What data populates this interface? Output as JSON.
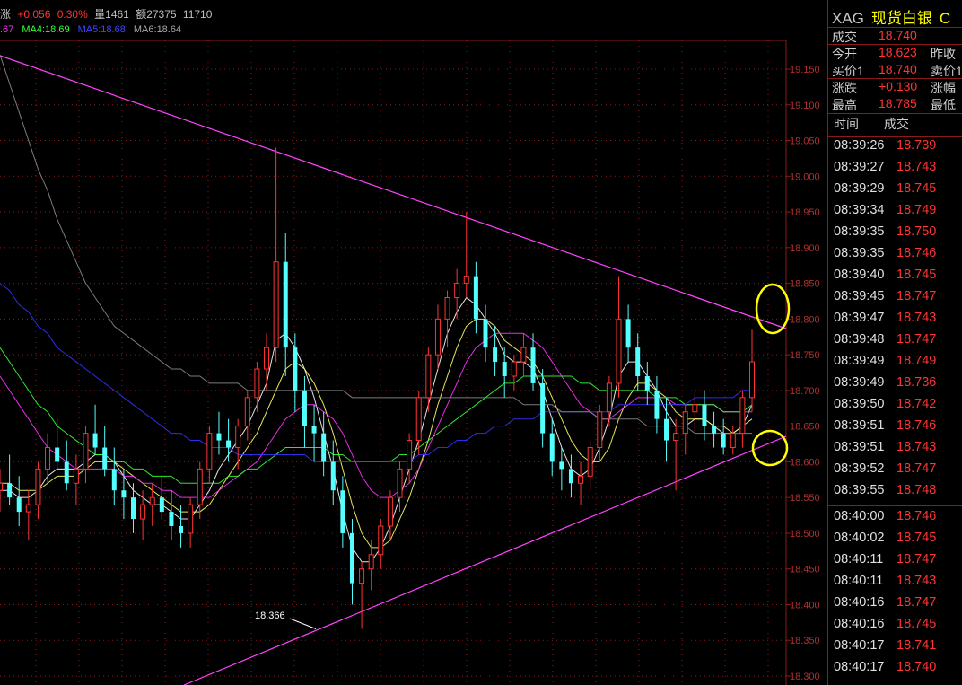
{
  "header": {
    "change_label": "涨",
    "change": "+0.056",
    "change_pct": "0.30%",
    "volume_label": "量",
    "volume": "1461",
    "amount_label": "额",
    "amount": "27375",
    "open_interest": "11710"
  },
  "ma_legend": {
    "ma_cut": ".67",
    "ma4": "MA4:18.69",
    "ma5": "MA5:18.68",
    "ma6": "MA6:18.64"
  },
  "colors": {
    "up": "#ff3333",
    "down": "#54ffff",
    "grid": "#8b1a1a",
    "trendline": "#ff44ff",
    "ma1": "#ffffff",
    "ma2": "#ffff66",
    "ma3": "#ff33ff",
    "ma4": "#33ff33",
    "ma5": "#3333ff",
    "ma6": "#888888",
    "highlight": "#ffff00"
  },
  "chart_data": {
    "type": "candlestick",
    "y_ticks": [
      "19.150",
      "19.100",
      "19.050",
      "19.000",
      "18.950",
      "18.900",
      "18.850",
      "18.800",
      "18.750",
      "18.700",
      "18.650",
      "18.600",
      "18.550",
      "18.500",
      "18.450",
      "18.400",
      "18.350",
      "18.300"
    ],
    "ylim": [
      18.29,
      19.21
    ],
    "annotation_low": "18.366",
    "candles": [
      [
        18.56,
        18.59,
        18.53,
        18.57
      ],
      [
        18.57,
        18.61,
        18.54,
        18.55
      ],
      [
        18.55,
        18.58,
        18.51,
        18.53
      ],
      [
        18.53,
        18.56,
        18.49,
        18.54
      ],
      [
        18.54,
        18.6,
        18.52,
        18.59
      ],
      [
        18.59,
        18.64,
        18.57,
        18.62
      ],
      [
        18.62,
        18.66,
        18.59,
        18.6
      ],
      [
        18.6,
        18.63,
        18.56,
        18.57
      ],
      [
        18.57,
        18.61,
        18.54,
        18.59
      ],
      [
        18.59,
        18.65,
        18.57,
        18.64
      ],
      [
        18.64,
        18.68,
        18.61,
        18.62
      ],
      [
        18.62,
        18.65,
        18.58,
        18.59
      ],
      [
        18.59,
        18.62,
        18.54,
        18.56
      ],
      [
        18.56,
        18.59,
        18.52,
        18.55
      ],
      [
        18.55,
        18.57,
        18.5,
        18.52
      ],
      [
        18.52,
        18.56,
        18.49,
        18.54
      ],
      [
        18.54,
        18.57,
        18.51,
        18.55
      ],
      [
        18.55,
        18.58,
        18.52,
        18.53
      ],
      [
        18.53,
        18.56,
        18.49,
        18.51
      ],
      [
        18.51,
        18.54,
        18.48,
        18.5
      ],
      [
        18.5,
        18.55,
        18.48,
        18.54
      ],
      [
        18.54,
        18.6,
        18.52,
        18.59
      ],
      [
        18.59,
        18.65,
        18.57,
        18.64
      ],
      [
        18.64,
        18.67,
        18.61,
        18.63
      ],
      [
        18.63,
        18.66,
        18.6,
        18.62
      ],
      [
        18.62,
        18.66,
        18.59,
        18.65
      ],
      [
        18.65,
        18.7,
        18.63,
        18.69
      ],
      [
        18.69,
        18.74,
        18.67,
        18.73
      ],
      [
        18.73,
        18.78,
        18.7,
        18.76
      ],
      [
        18.76,
        19.04,
        18.74,
        18.88
      ],
      [
        18.88,
        18.92,
        18.72,
        18.76
      ],
      [
        18.76,
        18.78,
        18.67,
        18.7
      ],
      [
        18.7,
        18.72,
        18.62,
        18.65
      ],
      [
        18.65,
        18.68,
        18.6,
        18.64
      ],
      [
        18.64,
        18.67,
        18.58,
        18.6
      ],
      [
        18.6,
        18.63,
        18.54,
        18.56
      ],
      [
        18.56,
        18.58,
        18.48,
        18.5
      ],
      [
        18.5,
        18.52,
        18.4,
        18.43
      ],
      [
        18.43,
        18.46,
        18.366,
        18.45
      ],
      [
        18.45,
        18.49,
        18.42,
        18.47
      ],
      [
        18.47,
        18.52,
        18.45,
        18.51
      ],
      [
        18.51,
        18.56,
        18.49,
        18.55
      ],
      [
        18.55,
        18.6,
        18.53,
        18.59
      ],
      [
        18.59,
        18.64,
        18.57,
        18.63
      ],
      [
        18.63,
        18.7,
        18.61,
        18.69
      ],
      [
        18.69,
        18.76,
        18.67,
        18.75
      ],
      [
        18.75,
        18.82,
        18.73,
        18.8
      ],
      [
        18.8,
        18.84,
        18.76,
        18.83
      ],
      [
        18.83,
        18.87,
        18.8,
        18.85
      ],
      [
        18.85,
        18.95,
        18.83,
        18.86
      ],
      [
        18.86,
        18.88,
        18.78,
        18.8
      ],
      [
        18.8,
        18.82,
        18.74,
        18.76
      ],
      [
        18.76,
        18.79,
        18.72,
        18.74
      ],
      [
        18.74,
        18.76,
        18.69,
        18.72
      ],
      [
        18.72,
        18.75,
        18.7,
        18.74
      ],
      [
        18.74,
        18.78,
        18.72,
        18.76
      ],
      [
        18.76,
        18.78,
        18.7,
        18.71
      ],
      [
        18.71,
        18.73,
        18.62,
        18.64
      ],
      [
        18.64,
        18.66,
        18.58,
        18.6
      ],
      [
        18.6,
        18.62,
        18.56,
        18.59
      ],
      [
        18.59,
        18.61,
        18.55,
        18.57
      ],
      [
        18.57,
        18.6,
        18.54,
        18.58
      ],
      [
        18.58,
        18.63,
        18.56,
        18.62
      ],
      [
        18.62,
        18.68,
        18.6,
        18.67
      ],
      [
        18.67,
        18.72,
        18.65,
        18.71
      ],
      [
        18.71,
        18.86,
        18.69,
        18.8
      ],
      [
        18.8,
        18.82,
        18.74,
        18.76
      ],
      [
        18.76,
        18.78,
        18.7,
        18.72
      ],
      [
        18.72,
        18.74,
        18.68,
        18.7
      ],
      [
        18.7,
        18.72,
        18.64,
        18.66
      ],
      [
        18.66,
        18.69,
        18.6,
        18.63
      ],
      [
        18.63,
        18.66,
        18.56,
        18.64
      ],
      [
        18.64,
        18.68,
        18.61,
        18.67
      ],
      [
        18.67,
        18.7,
        18.64,
        18.68
      ],
      [
        18.68,
        18.7,
        18.63,
        18.65
      ],
      [
        18.65,
        18.67,
        18.62,
        18.64
      ],
      [
        18.64,
        18.66,
        18.61,
        18.62
      ],
      [
        18.62,
        18.65,
        18.61,
        18.64
      ],
      [
        18.64,
        18.7,
        18.62,
        18.69
      ],
      [
        18.69,
        18.785,
        18.67,
        18.74
      ]
    ],
    "ma_series": {
      "ma1": [
        18.56,
        18.56,
        18.55,
        18.55,
        18.56,
        18.58,
        18.59,
        18.59,
        18.59,
        18.6,
        18.61,
        18.61,
        18.6,
        18.58,
        18.56,
        18.55,
        18.54,
        18.54,
        18.53,
        18.52,
        18.52,
        18.54,
        18.56,
        18.59,
        18.61,
        18.63,
        18.65,
        18.68,
        18.71,
        18.77,
        18.78,
        18.76,
        18.73,
        18.69,
        18.64,
        18.59,
        18.53,
        18.48,
        18.46,
        18.46,
        18.48,
        18.51,
        18.55,
        18.59,
        18.63,
        18.68,
        18.73,
        18.78,
        18.81,
        18.83,
        18.82,
        18.8,
        18.78,
        18.75,
        18.74,
        18.74,
        18.73,
        18.7,
        18.66,
        18.62,
        18.59,
        18.58,
        18.59,
        18.62,
        18.66,
        18.72,
        18.74,
        18.74,
        18.72,
        18.7,
        18.67,
        18.65,
        18.65,
        18.66,
        18.66,
        18.65,
        18.64,
        18.64,
        18.65,
        18.68
      ],
      "ma2": [
        18.57,
        18.57,
        18.56,
        18.56,
        18.56,
        18.57,
        18.58,
        18.58,
        18.58,
        18.59,
        18.6,
        18.6,
        18.6,
        18.59,
        18.58,
        18.57,
        18.56,
        18.55,
        18.54,
        18.53,
        18.53,
        18.53,
        18.54,
        18.56,
        18.58,
        18.6,
        18.62,
        18.64,
        18.67,
        18.7,
        18.73,
        18.74,
        18.73,
        18.71,
        18.68,
        18.64,
        18.59,
        18.54,
        18.5,
        18.48,
        18.48,
        18.49,
        18.52,
        18.55,
        18.59,
        18.63,
        18.68,
        18.72,
        18.76,
        18.79,
        18.8,
        18.8,
        18.79,
        18.77,
        18.76,
        18.75,
        18.74,
        18.72,
        18.69,
        18.66,
        18.63,
        18.61,
        18.6,
        18.6,
        18.62,
        18.66,
        18.69,
        18.71,
        18.71,
        18.7,
        18.69,
        18.67,
        18.66,
        18.66,
        18.66,
        18.65,
        18.65,
        18.64,
        18.65,
        18.66
      ],
      "ma3": [
        18.72,
        18.7,
        18.68,
        18.66,
        18.64,
        18.62,
        18.61,
        18.6,
        18.59,
        18.59,
        18.59,
        18.59,
        18.59,
        18.58,
        18.58,
        18.57,
        18.57,
        18.56,
        18.56,
        18.55,
        18.55,
        18.55,
        18.55,
        18.56,
        18.57,
        18.58,
        18.59,
        18.6,
        18.62,
        18.64,
        18.66,
        18.67,
        18.68,
        18.68,
        18.67,
        18.66,
        18.64,
        18.61,
        18.58,
        18.56,
        18.55,
        18.55,
        18.56,
        18.57,
        18.59,
        18.62,
        18.65,
        18.68,
        18.71,
        18.74,
        18.76,
        18.77,
        18.78,
        18.78,
        18.78,
        18.78,
        18.77,
        18.76,
        18.74,
        18.72,
        18.7,
        18.68,
        18.67,
        18.66,
        18.66,
        18.67,
        18.68,
        18.69,
        18.69,
        18.69,
        18.69,
        18.68,
        18.68,
        18.68,
        18.68,
        18.68,
        18.67,
        18.67,
        18.67,
        18.67
      ],
      "ma4": [
        18.76,
        18.74,
        18.72,
        18.7,
        18.68,
        18.67,
        18.65,
        18.64,
        18.63,
        18.62,
        18.61,
        18.61,
        18.6,
        18.6,
        18.59,
        18.59,
        18.58,
        18.58,
        18.58,
        18.57,
        18.57,
        18.57,
        18.57,
        18.57,
        18.58,
        18.58,
        18.59,
        18.59,
        18.6,
        18.61,
        18.62,
        18.62,
        18.62,
        18.62,
        18.62,
        18.61,
        18.61,
        18.6,
        18.6,
        18.6,
        18.6,
        18.6,
        18.61,
        18.61,
        18.62,
        18.63,
        18.64,
        18.65,
        18.66,
        18.67,
        18.68,
        18.69,
        18.7,
        18.71,
        18.71,
        18.72,
        18.72,
        18.72,
        18.72,
        18.72,
        18.72,
        18.71,
        18.71,
        18.7,
        18.7,
        18.7,
        18.7,
        18.7,
        18.7,
        18.69,
        18.69,
        18.69,
        18.68,
        18.68,
        18.68,
        18.68,
        18.67,
        18.67,
        18.67,
        18.68
      ],
      "ma5": [
        18.85,
        18.84,
        18.82,
        18.81,
        18.79,
        18.78,
        18.76,
        18.75,
        18.74,
        18.73,
        18.72,
        18.71,
        18.7,
        18.69,
        18.68,
        18.67,
        18.66,
        18.65,
        18.64,
        18.64,
        18.63,
        18.63,
        18.62,
        18.62,
        18.62,
        18.61,
        18.61,
        18.61,
        18.61,
        18.61,
        18.61,
        18.61,
        18.61,
        18.6,
        18.6,
        18.6,
        18.6,
        18.6,
        18.6,
        18.6,
        18.6,
        18.6,
        18.6,
        18.6,
        18.61,
        18.61,
        18.62,
        18.62,
        18.63,
        18.63,
        18.64,
        18.64,
        18.65,
        18.65,
        18.66,
        18.66,
        18.66,
        18.67,
        18.67,
        18.67,
        18.67,
        18.67,
        18.67,
        18.67,
        18.67,
        18.68,
        18.68,
        18.68,
        18.68,
        18.68,
        18.68,
        18.68,
        18.68,
        18.69,
        18.69,
        18.69,
        18.69,
        18.69,
        18.7,
        18.7
      ],
      "ma6": [
        19.17,
        19.13,
        19.09,
        19.05,
        19.01,
        18.98,
        18.94,
        18.91,
        18.88,
        18.85,
        18.83,
        18.81,
        18.79,
        18.78,
        18.77,
        18.76,
        18.75,
        18.74,
        18.73,
        18.73,
        18.72,
        18.72,
        18.71,
        18.71,
        18.71,
        18.71,
        18.7,
        18.7,
        18.7,
        18.7,
        18.7,
        18.7,
        18.7,
        18.7,
        18.7,
        18.7,
        18.7,
        18.69,
        18.69,
        18.69,
        18.69,
        18.69,
        18.69,
        18.69,
        18.69,
        18.69,
        18.69,
        18.69,
        18.69,
        18.69,
        18.69,
        18.69,
        18.69,
        18.69,
        18.69,
        18.68,
        18.68,
        18.68,
        18.68,
        18.67,
        18.67,
        18.67,
        18.67,
        18.66,
        18.66,
        18.66,
        18.66,
        18.66,
        18.65,
        18.65,
        18.65,
        18.65,
        18.65,
        18.64,
        18.64,
        18.64,
        18.64,
        18.64,
        18.64,
        18.64
      ]
    }
  },
  "sidebar": {
    "symbol": "XAG",
    "name": "现货白银",
    "extra": "C",
    "quotes": [
      {
        "label": "成交",
        "value": "18.740",
        "label2": ""
      },
      {
        "label": "今开",
        "value": "18.623",
        "label2": "昨收"
      },
      {
        "label": "买价1",
        "value": "18.740",
        "label2": "卖价1"
      },
      {
        "label": "涨跌",
        "value": "+0.130",
        "label2": "涨幅"
      },
      {
        "label": "最高",
        "value": "18.785",
        "label2": "最低"
      }
    ],
    "trade_header": {
      "time": "时间",
      "price": "成交"
    },
    "trades": [
      {
        "time": "08:39:26",
        "price": "18.739"
      },
      {
        "time": "08:39:27",
        "price": "18.743"
      },
      {
        "time": "08:39:29",
        "price": "18.745"
      },
      {
        "time": "08:39:34",
        "price": "18.749"
      },
      {
        "time": "08:39:35",
        "price": "18.750"
      },
      {
        "time": "08:39:35",
        "price": "18.746"
      },
      {
        "time": "08:39:40",
        "price": "18.745"
      },
      {
        "time": "08:39:45",
        "price": "18.747"
      },
      {
        "time": "08:39:47",
        "price": "18.743"
      },
      {
        "time": "08:39:48",
        "price": "18.747"
      },
      {
        "time": "08:39:49",
        "price": "18.749"
      },
      {
        "time": "08:39:49",
        "price": "18.736"
      },
      {
        "time": "08:39:50",
        "price": "18.742"
      },
      {
        "time": "08:39:51",
        "price": "18.746"
      },
      {
        "time": "08:39:51",
        "price": "18.743"
      },
      {
        "time": "08:39:52",
        "price": "18.747"
      },
      {
        "time": "08:39:55",
        "price": "18.748"
      },
      {
        "time": "08:40:00",
        "price": "18.746"
      },
      {
        "time": "08:40:02",
        "price": "18.745"
      },
      {
        "time": "08:40:11",
        "price": "18.747"
      },
      {
        "time": "08:40:11",
        "price": "18.743"
      },
      {
        "time": "08:40:16",
        "price": "18.747"
      },
      {
        "time": "08:40:16",
        "price": "18.745"
      },
      {
        "time": "08:40:17",
        "price": "18.741"
      },
      {
        "time": "08:40:17",
        "price": "18.740"
      }
    ]
  }
}
